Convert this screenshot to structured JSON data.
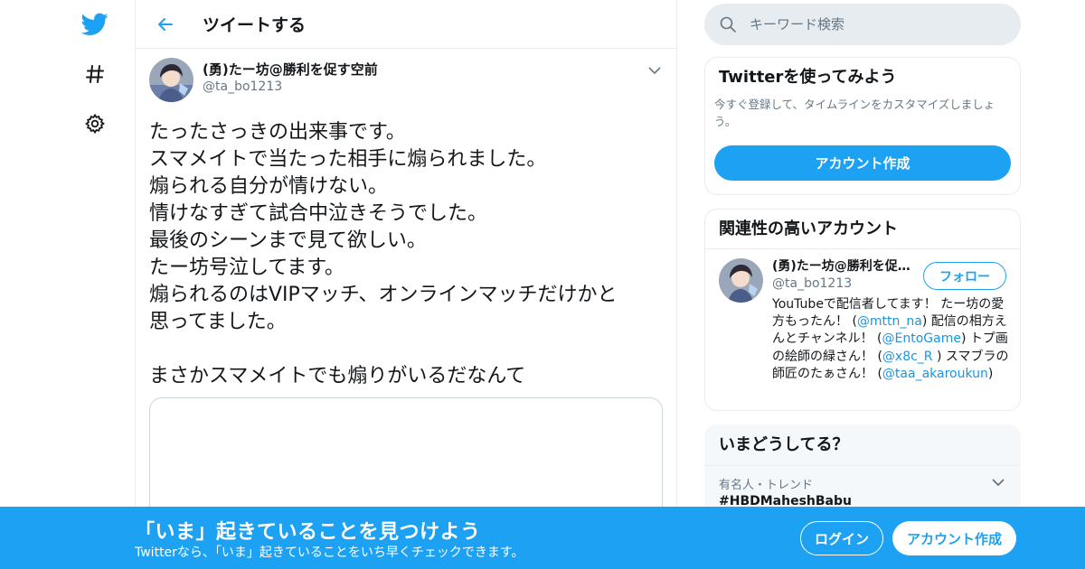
{
  "nav": {
    "logo_icon": "twitter-bird-icon",
    "explore_icon": "hashtag-icon",
    "settings_icon": "gear-icon"
  },
  "header": {
    "back_icon": "arrow-left-icon",
    "title": "ツイートする"
  },
  "tweet": {
    "author_name": "(勇)たー坊@勝利を促す空前",
    "author_handle": "@ta_bo1213",
    "body": "たったさっきの出来事です。\nスマメイトで当たった相手に煽られました。\n煽られる自分が情けない。\n情けなすぎて試合中泣きそうでした。\n最後のシーンまで見て欲しい。\nたー坊号泣してます。\n煽られるのはVIPマッチ、オンラインマッチだけかと\n思ってました。\n\nまさかスマメイトでも煽りがいるだなんて"
  },
  "search": {
    "placeholder": "キーワード検索"
  },
  "signup_card": {
    "title": "Twitterを使ってみよう",
    "description": "今すぐ登録して、タイムラインをカスタマイズしましょう。",
    "button": "アカウント作成"
  },
  "related": {
    "title": "関連性の高いアカウント",
    "account": {
      "name": "(勇)たー坊@勝利を促す空前",
      "handle": "@ta_bo1213",
      "follow_label": "フォロー",
      "bio_1": "YouTubeで配信者してます！ たー坊の愛方もったん！ (",
      "mention_1": "@mttn_na",
      "bio_2": ") 配信の相方えんとチャンネル！ (",
      "mention_2": "@EntoGame",
      "bio_3": ") トプ画の絵師の緑さん！ (",
      "mention_3": "@x8c_R",
      "bio_4": " ) スマブラの師匠のたぁさん！ (",
      "mention_4": "@taa_akaroukun",
      "bio_5": ")"
    }
  },
  "trends": {
    "title": "いまどうしてる？",
    "items": [
      {
        "meta": "有名人・トレンド",
        "name": "#HBDMaheshBabu"
      }
    ]
  },
  "bottom_bar": {
    "title": "「いま」起きていることを見つけよう",
    "subtitle": "Twitterなら、「いま」起きていることをいち早くチェックできます。",
    "login": "ログイン",
    "signup": "アカウント作成"
  },
  "colors": {
    "brand": "#1da1f2",
    "link": "#1b95e0",
    "muted": "#657786",
    "border": "#e6ecf0"
  }
}
